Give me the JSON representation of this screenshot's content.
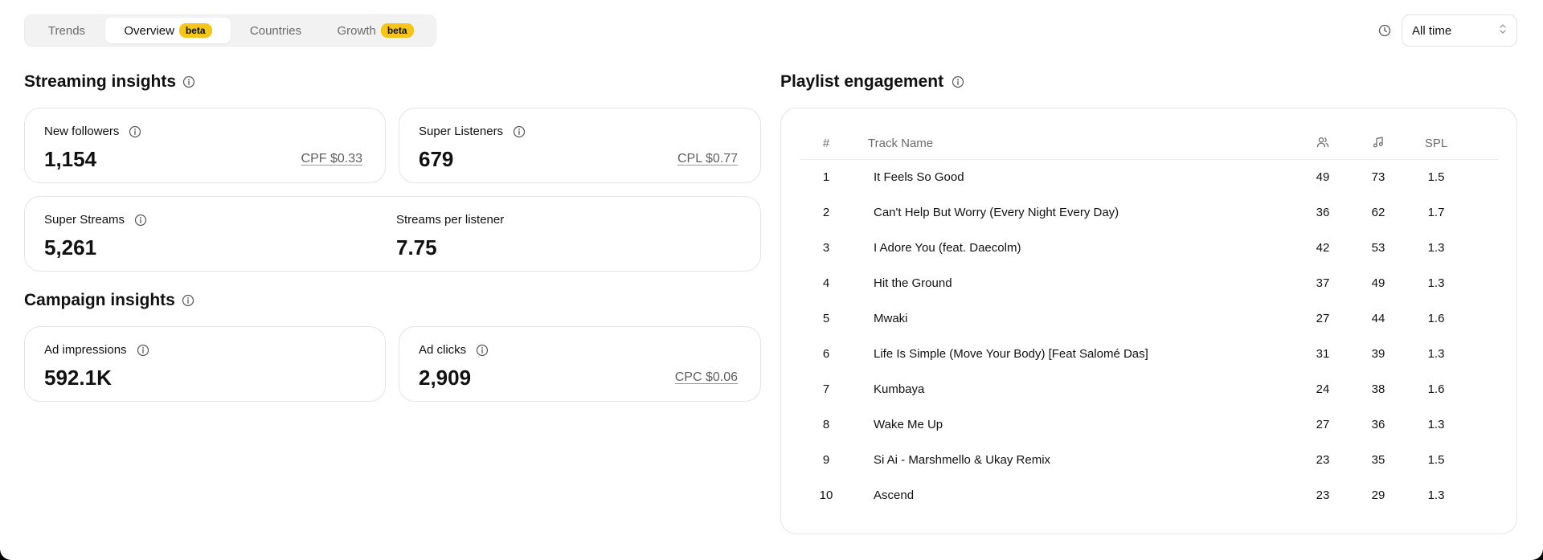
{
  "tabs": [
    {
      "label": "Trends",
      "badge": ""
    },
    {
      "label": "Overview",
      "badge": "beta"
    },
    {
      "label": "Countries",
      "badge": ""
    },
    {
      "label": "Growth",
      "badge": "beta"
    }
  ],
  "time_filter": {
    "selected": "All time"
  },
  "streaming": {
    "title": "Streaming insights",
    "new_followers": {
      "label": "New followers",
      "value": "1,154",
      "cost": "CPF $0.33"
    },
    "super_listeners": {
      "label": "Super Listeners",
      "value": "679",
      "cost": "CPL $0.77"
    },
    "super_streams": {
      "label": "Super Streams",
      "value": "5,261"
    },
    "streams_per_listener": {
      "label": "Streams per listener",
      "value": "7.75"
    }
  },
  "campaign": {
    "title": "Campaign insights",
    "ad_impressions": {
      "label": "Ad impressions",
      "value": "592.1K"
    },
    "ad_clicks": {
      "label": "Ad clicks",
      "value": "2,909",
      "cost": "CPC $0.06"
    }
  },
  "playlist": {
    "title": "Playlist engagement",
    "columns": {
      "num": "#",
      "track": "Track Name",
      "listeners_icon": "users-icon",
      "streams_icon": "music-note-icon",
      "spl": "SPL"
    },
    "rows": [
      {
        "num": "1",
        "name": "It Feels So Good",
        "listeners": "49",
        "streams": "73",
        "spl": "1.5"
      },
      {
        "num": "2",
        "name": "Can't Help But Worry (Every Night Every Day)",
        "listeners": "36",
        "streams": "62",
        "spl": "1.7"
      },
      {
        "num": "3",
        "name": "I Adore You (feat. Daecolm)",
        "listeners": "42",
        "streams": "53",
        "spl": "1.3"
      },
      {
        "num": "4",
        "name": "Hit the Ground",
        "listeners": "37",
        "streams": "49",
        "spl": "1.3"
      },
      {
        "num": "5",
        "name": "Mwaki",
        "listeners": "27",
        "streams": "44",
        "spl": "1.6"
      },
      {
        "num": "6",
        "name": "Life Is Simple (Move Your Body) [Feat Salomé Das]",
        "listeners": "31",
        "streams": "39",
        "spl": "1.3"
      },
      {
        "num": "7",
        "name": "Kumbaya",
        "listeners": "24",
        "streams": "38",
        "spl": "1.6"
      },
      {
        "num": "8",
        "name": "Wake Me Up",
        "listeners": "27",
        "streams": "36",
        "spl": "1.3"
      },
      {
        "num": "9",
        "name": "Si Ai - Marshmello & Ukay Remix",
        "listeners": "23",
        "streams": "35",
        "spl": "1.5"
      },
      {
        "num": "10",
        "name": "Ascend",
        "listeners": "23",
        "streams": "29",
        "spl": "1.3"
      }
    ]
  },
  "colors": {
    "badge": "#f5c51c",
    "border": "#e4e4e7",
    "muted_text": "#6b6b6b"
  }
}
